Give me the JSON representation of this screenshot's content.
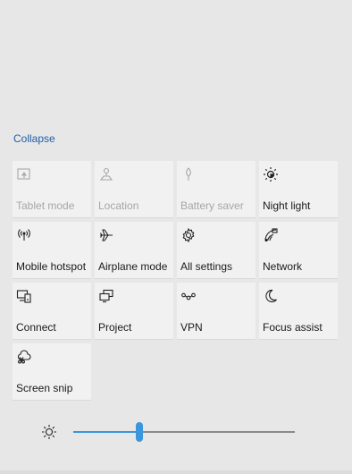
{
  "action_center": {
    "collapse_label": "Collapse",
    "tiles": [
      {
        "label": "Tablet mode",
        "icon": "tablet-mode-icon",
        "active": false
      },
      {
        "label": "Location",
        "icon": "location-icon",
        "active": false
      },
      {
        "label": "Battery saver",
        "icon": "battery-saver-icon",
        "active": false
      },
      {
        "label": "Night light",
        "icon": "night-light-icon",
        "active": true
      },
      {
        "label": "Mobile hotspot",
        "icon": "mobile-hotspot-icon",
        "active": true
      },
      {
        "label": "Airplane mode",
        "icon": "airplane-icon",
        "active": true
      },
      {
        "label": "All settings",
        "icon": "settings-gear-icon",
        "active": true
      },
      {
        "label": "Network",
        "icon": "network-icon",
        "active": true
      },
      {
        "label": "Connect",
        "icon": "connect-icon",
        "active": true
      },
      {
        "label": "Project",
        "icon": "project-icon",
        "active": true
      },
      {
        "label": "VPN",
        "icon": "vpn-icon",
        "active": true
      },
      {
        "label": "Focus assist",
        "icon": "moon-icon",
        "active": true
      },
      {
        "label": "Screen snip",
        "icon": "screen-snip-icon",
        "active": true
      }
    ],
    "brightness": {
      "icon": "brightness-sun-icon",
      "value_fraction": 0.3
    },
    "colors": {
      "accent": "#3a96dd",
      "link": "#1f5fa6"
    }
  }
}
